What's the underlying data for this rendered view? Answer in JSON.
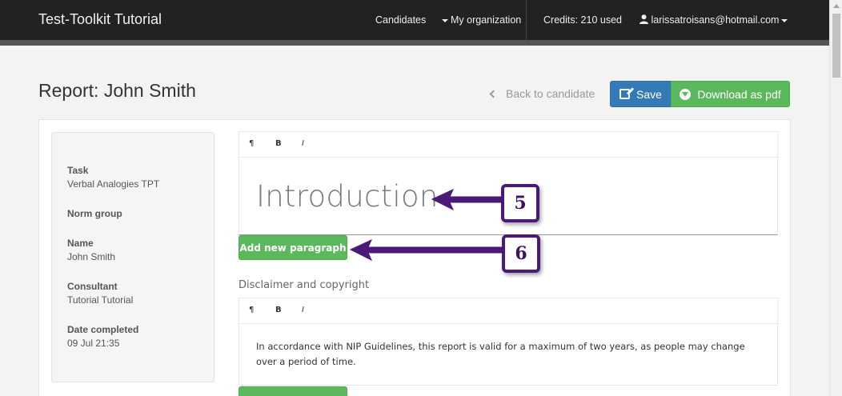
{
  "navbar": {
    "brand": "Test-Toolkit Tutorial",
    "candidates": "Candidates",
    "my_organization": "My organization",
    "credits": "Credits: 210 used",
    "user_email": "larissatroisans@hotmail.com"
  },
  "header": {
    "title": "Report: John Smith",
    "back_label": "Back to candidate",
    "save_label": "Save",
    "download_label": "Download as pdf"
  },
  "sidebar": {
    "fields": [
      {
        "label": "Task",
        "value": "Verbal Analogies TPT"
      },
      {
        "label": "Norm group",
        "value": ""
      },
      {
        "label": "Name",
        "value": "John Smith"
      },
      {
        "label": "Consultant",
        "value": "Tutorial Tutorial"
      },
      {
        "label": "Date completed",
        "value": "09 Jul 21:35"
      }
    ]
  },
  "toolbar": {
    "paragraph": "¶",
    "bold": "B",
    "italic": "I"
  },
  "editor1": {
    "heading": "Introduction",
    "add_paragraph_label": "Add new paragraph"
  },
  "editor2": {
    "section_label": "Disclaimer and copyright",
    "text": "In accordance with NIP Guidelines, this report is valid for a maximum of two years, as people may change over a period of time."
  },
  "annotations": {
    "callout_5": "5",
    "callout_6": "6",
    "color": "#4b1a78"
  },
  "colors": {
    "navbar": "#222222",
    "primary": "#337ab7",
    "success": "#5cb85c"
  }
}
